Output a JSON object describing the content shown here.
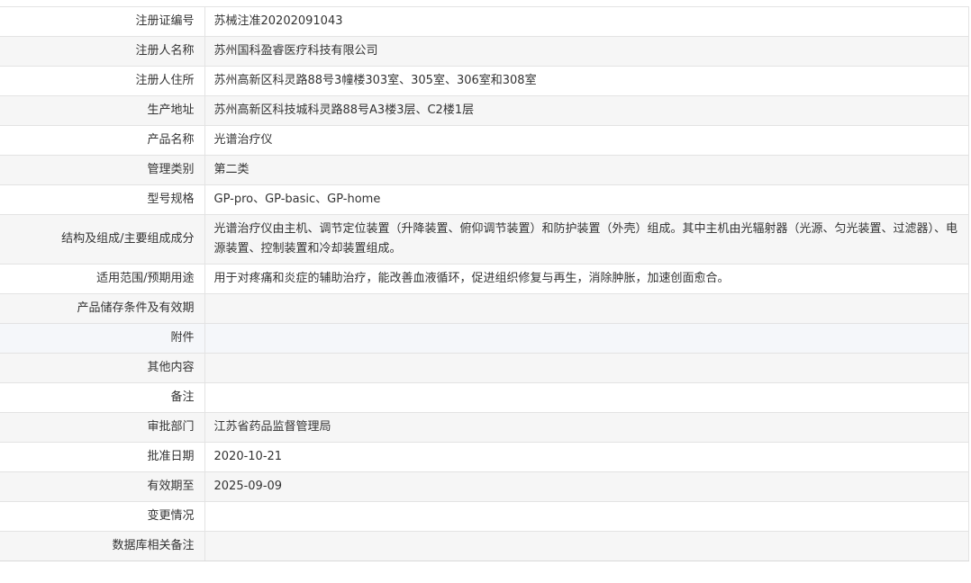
{
  "rows": [
    {
      "label": "注册证编号",
      "value": "苏械注准20202091043"
    },
    {
      "label": "注册人名称",
      "value": "苏州国科盈睿医疗科技有限公司"
    },
    {
      "label": "注册人住所",
      "value": "苏州高新区科灵路88号3幢楼303室、305室、306室和308室"
    },
    {
      "label": "生产地址",
      "value": "苏州高新区科技城科灵路88号A3楼3层、C2楼1层"
    },
    {
      "label": "产品名称",
      "value": "光谱治疗仪"
    },
    {
      "label": "管理类别",
      "value": "第二类"
    },
    {
      "label": "型号规格",
      "value": "GP-pro、GP-basic、GP-home"
    },
    {
      "label": "结构及组成/主要组成成分",
      "value": "光谱治疗仪由主机、调节定位装置（升降装置、俯仰调节装置）和防护装置（外壳）组成。其中主机由光辐射器（光源、匀光装置、过滤器）、电源装置、控制装置和冷却装置组成。"
    },
    {
      "label": "适用范围/预期用途",
      "value": "用于对疼痛和炎症的辅助治疗，能改善血液循环，促进组织修复与再生，消除肿胀，加速创面愈合。"
    },
    {
      "label": "产品储存条件及有效期",
      "value": ""
    },
    {
      "label": "附件",
      "value": ""
    },
    {
      "label": "其他内容",
      "value": ""
    },
    {
      "label": "备注",
      "value": ""
    },
    {
      "label": "审批部门",
      "value": "江苏省药品监督管理局"
    },
    {
      "label": "批准日期",
      "value": "2020-10-21"
    },
    {
      "label": "有效期至",
      "value": "2025-09-09"
    },
    {
      "label": "变更情况",
      "value": ""
    },
    {
      "label": "数据库相关备注",
      "value": ""
    }
  ]
}
